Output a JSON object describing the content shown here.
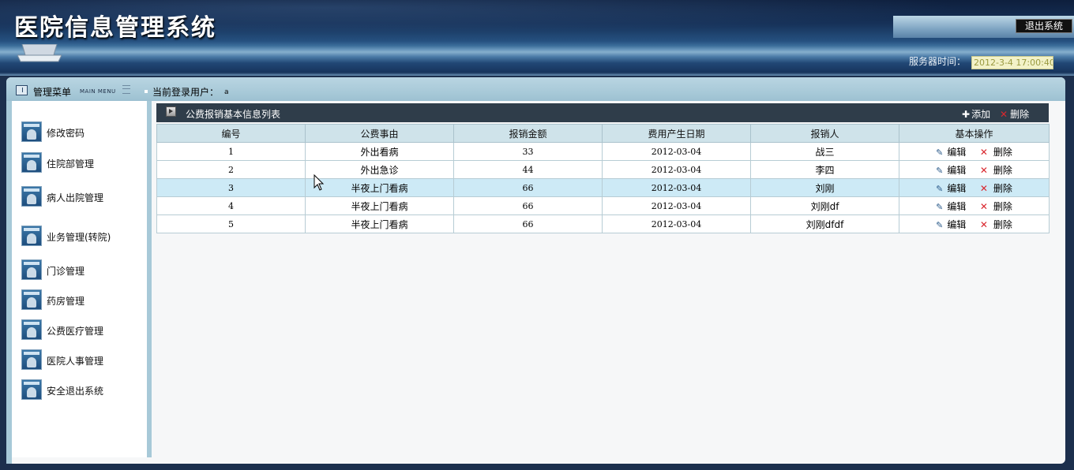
{
  "app": {
    "title": "医院信息管理系统"
  },
  "header": {
    "logout_label": "退出系统",
    "server_time_label": "服务器时间：",
    "server_time": "2012-3-4 17:00:40"
  },
  "topbar": {
    "menu_title": "管理菜单",
    "menu_subtitle": "MAIN MENU",
    "user_label": "当前登录用户：",
    "user_name": "a"
  },
  "sidebar": {
    "items": [
      {
        "label": "修改密码",
        "icon": "window-icon"
      },
      {
        "label": "住院部管理",
        "icon": "window-icon"
      },
      {
        "label": "病人出院管理",
        "icon": "window-icon"
      },
      {
        "label": "业务管理(转院)",
        "icon": "window-icon"
      },
      {
        "label": "门诊管理",
        "icon": "window-icon"
      },
      {
        "label": "药房管理",
        "icon": "window-icon"
      },
      {
        "label": "公费医疗管理",
        "icon": "window-icon"
      },
      {
        "label": "医院人事管理",
        "icon": "window-icon"
      },
      {
        "label": "安全退出系统",
        "icon": "window-icon"
      }
    ]
  },
  "list": {
    "title": "公费报销基本信息列表",
    "add_label": "添加",
    "delete_label": "删除",
    "columns": [
      "编号",
      "公费事由",
      "报销金额",
      "费用产生日期",
      "报销人",
      "基本操作"
    ],
    "edit_label": "编辑",
    "row_delete_label": "删除",
    "rows": [
      {
        "id": "1",
        "reason": "外出看病",
        "amount": "33",
        "date": "2012-03-04",
        "person": "战三"
      },
      {
        "id": "2",
        "reason": "外出急诊",
        "amount": "44",
        "date": "2012-03-04",
        "person": "李四"
      },
      {
        "id": "3",
        "reason": "半夜上门看病",
        "amount": "66",
        "date": "2012-03-04",
        "person": "刘刚"
      },
      {
        "id": "4",
        "reason": "半夜上门看病",
        "amount": "66",
        "date": "2012-03-04",
        "person": "刘刚df"
      },
      {
        "id": "5",
        "reason": "半夜上门看病",
        "amount": "66",
        "date": "2012-03-04",
        "person": "刘刚dfdf"
      }
    ],
    "highlighted_row": 3
  },
  "colors": {
    "header_dark": "#163158",
    "menu_bar": "#a7c9d8",
    "table_header": "#cfe3ea",
    "list_header": "#2f3d4a",
    "highlight_row": "#cdeaf6",
    "delete_red": "#d9272e"
  }
}
